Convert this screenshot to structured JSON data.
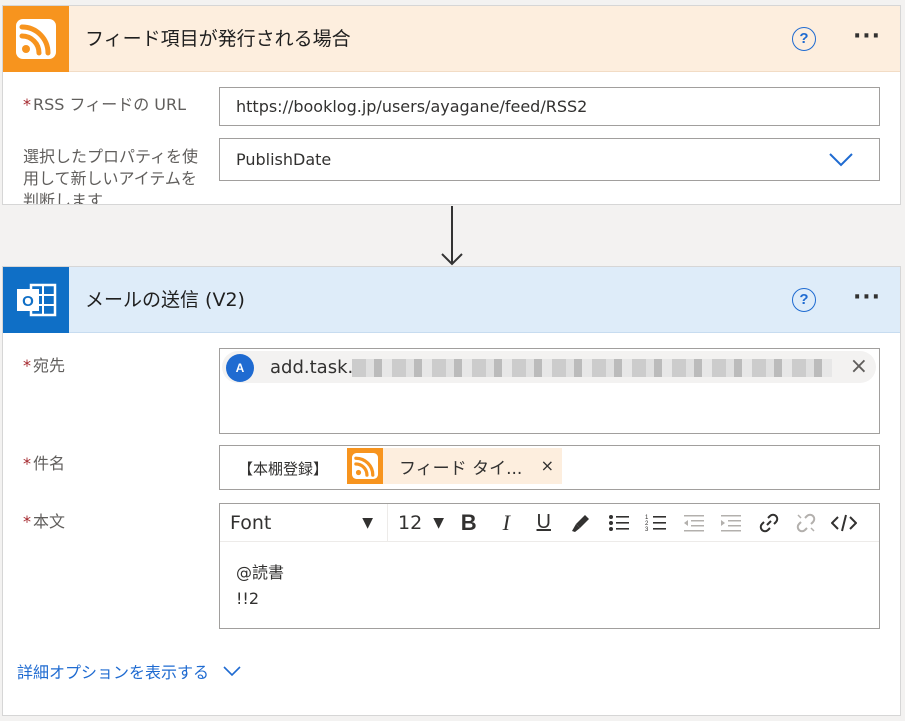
{
  "trigger": {
    "title": "フィード項目が発行される場合",
    "rss_url_label": "RSS フィードの URL",
    "rss_url_value": "https://booklog.jp/users/ayagane/feed/RSS2",
    "property_label": "選択したプロパティを使用して新しいアイテムを判断します",
    "property_value": "PublishDate",
    "help_label": "?",
    "accent": "#f7941e"
  },
  "action": {
    "title": "メールの送信 (V2)",
    "help_label": "?",
    "to_label": "宛先",
    "recipient_initial": "A",
    "recipient_text": "add.task.",
    "subject_label": "件名",
    "subject_prefix": "【本棚登録】",
    "subject_token": "フィード タイ...",
    "body_label": "本文",
    "toolbar": {
      "font": "Font",
      "size": "12"
    },
    "body_lines": [
      "@読書",
      "!!2"
    ],
    "advanced_link": "詳細オプションを表示する",
    "accent": "#0f6fc6"
  },
  "icons": [
    "rss-icon",
    "outlook-icon",
    "help-icon",
    "more-icon",
    "chevron-down-icon",
    "close-icon",
    "bold-icon",
    "italic-icon",
    "underline-icon",
    "brush-icon",
    "bullet-list-icon",
    "numbered-list-icon",
    "outdent-icon",
    "indent-icon",
    "link-icon",
    "unlink-icon",
    "code-view-icon"
  ]
}
